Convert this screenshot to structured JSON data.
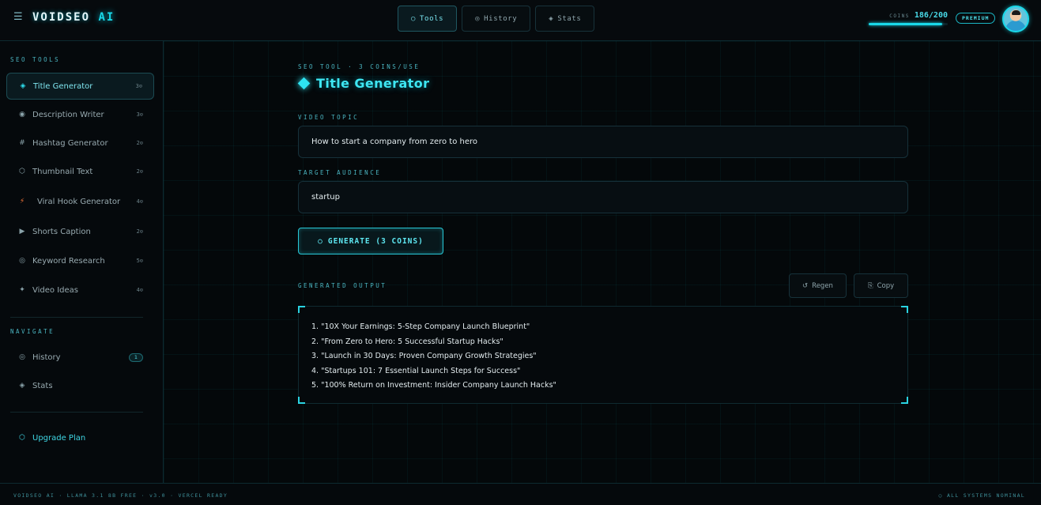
{
  "header": {
    "logo_main": "VOIDSEO",
    "logo_accent": "AI",
    "tabs": [
      {
        "icon": "○",
        "label": "Tools"
      },
      {
        "icon": "◎",
        "label": "History"
      },
      {
        "icon": "◈",
        "label": "Stats"
      }
    ],
    "coins_label": "COINS",
    "coins_value": "186/200",
    "coins_fraction": 0.93,
    "plan_badge": "PREMIUM"
  },
  "sidebar": {
    "tools_heading": "SEO TOOLS",
    "tools": [
      {
        "icon": "◈",
        "label": "Title Generator",
        "cost": "3⊙"
      },
      {
        "icon": "◉",
        "label": "Description Writer",
        "cost": "3⊙"
      },
      {
        "icon": "#",
        "label": "Hashtag Generator",
        "cost": "2⊙"
      },
      {
        "icon": "⬡",
        "label": "Thumbnail Text",
        "cost": "2⊙"
      },
      {
        "icon": "⚡",
        "label": "Viral Hook Generator",
        "cost": "4⊙"
      },
      {
        "icon": "▶",
        "label": "Shorts Caption",
        "cost": "2⊙"
      },
      {
        "icon": "◎",
        "label": "Keyword Research",
        "cost": "5⊙"
      },
      {
        "icon": "✦",
        "label": "Video Ideas",
        "cost": "4⊙"
      }
    ],
    "navigate_heading": "NAVIGATE",
    "navigate": [
      {
        "icon": "◎",
        "label": "History",
        "badge": "1"
      },
      {
        "icon": "◈",
        "label": "Stats"
      }
    ],
    "upgrade": {
      "icon": "⬡",
      "label": "Upgrade Plan"
    }
  },
  "main": {
    "kicker": "SEO TOOL · 3 COINS/USE",
    "title": "Title Generator",
    "topic_label": "VIDEO TOPIC",
    "topic_value": "How to start a company from zero to hero",
    "audience_label": "TARGET AUDIENCE",
    "audience_value": "startup",
    "generate_label": "GENERATE (3 COINS)",
    "generate_icon": "○",
    "output_label": "GENERATED OUTPUT",
    "regen_icon": "↺",
    "regen_label": "Regen",
    "copy_icon": "⎘",
    "copy_label": "Copy",
    "output_lines": [
      "1. \"10X Your Earnings: 5-Step Company Launch Blueprint\"",
      "2. \"From Zero to Hero: 5 Successful Startup Hacks\"",
      "3. \"Launch in 30 Days: Proven Company Growth Strategies\"",
      "4. \"Startups 101: 7 Essential Launch Steps for Success\"",
      "5. \"100% Return on Investment: Insider Company Launch Hacks\""
    ]
  },
  "footer": {
    "left": "VOIDSEO AI · LLAMA 3.1 8B FREE · v3.0 · VERCEL READY",
    "right": "○ ALL SYSTEMS NOMINAL"
  },
  "colors": {
    "accent": "#19d8e8",
    "background": "#05080b",
    "border": "#16313a"
  }
}
